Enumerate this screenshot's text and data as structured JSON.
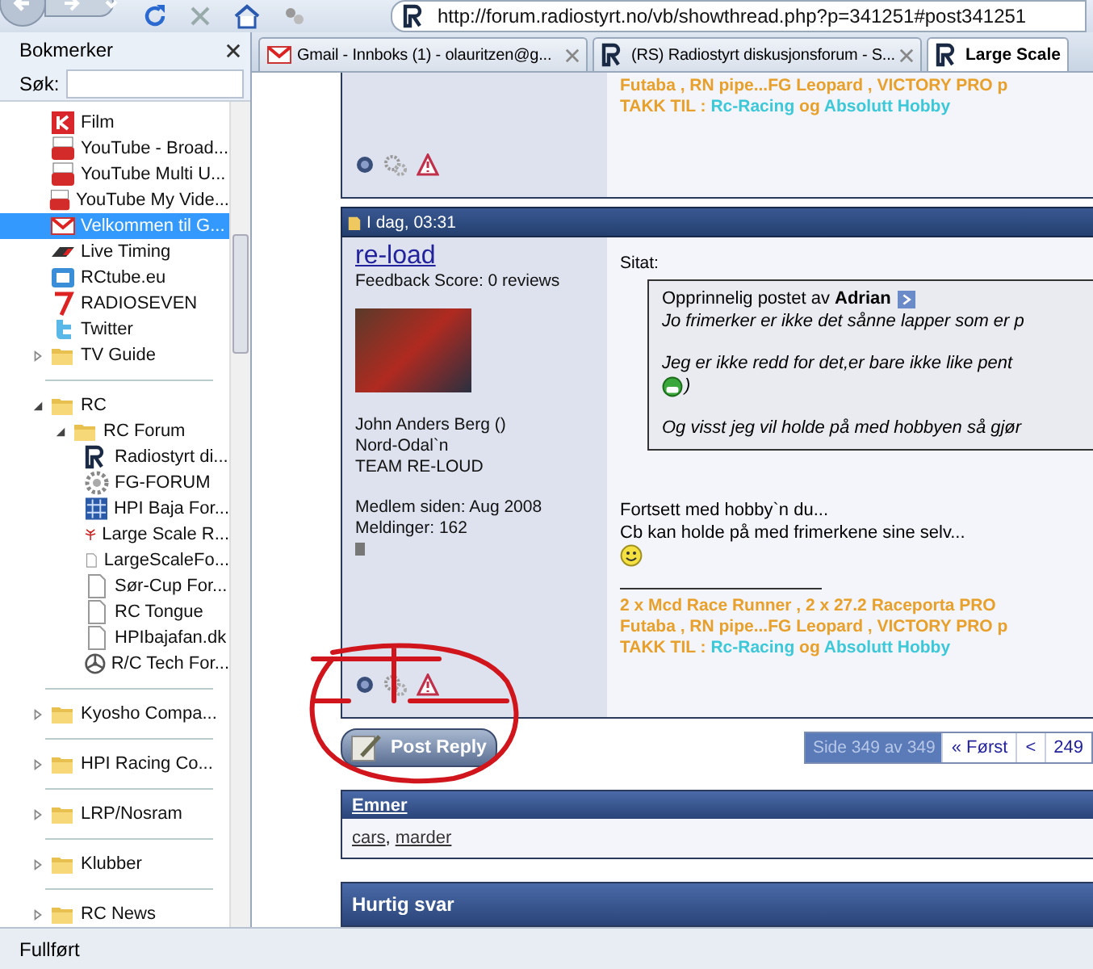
{
  "toolbar": {
    "address": "http://forum.radiostyrt.no/vb/showthread.php?p=341251#post341251"
  },
  "sidebar": {
    "title": "Bokmerker",
    "search": {
      "label": "Søk:"
    },
    "groups": [
      [
        {
          "label": "Film",
          "kind": "film",
          "selected": false
        },
        {
          "label": "YouTube - Broad...",
          "kind": "youtube",
          "selected": false
        },
        {
          "label": "YouTube Multi U...",
          "kind": "youtube",
          "selected": false
        },
        {
          "label": "YouTube My Vide...",
          "kind": "youtube",
          "selected": false
        },
        {
          "label": "Velkommen til G...",
          "kind": "mail",
          "selected": true
        },
        {
          "label": "Live Timing",
          "kind": "timing",
          "selected": false
        },
        {
          "label": "RCtube.eu",
          "kind": "rctube",
          "selected": false
        },
        {
          "label": "RADIOSEVEN",
          "kind": "seven",
          "selected": false
        },
        {
          "label": "Twitter",
          "kind": "twitter",
          "selected": false
        },
        {
          "label": "TV Guide",
          "kind": "folder",
          "selected": false,
          "expanded": false
        }
      ],
      [
        {
          "label": "RC",
          "kind": "folder",
          "selected": false,
          "expanded": true,
          "children": [
            {
              "label": "RC Forum",
              "kind": "folder",
              "selected": false,
              "expanded": true,
              "children": [
                {
                  "label": "Radiostyrt di...",
                  "kind": "rs",
                  "selected": false
                },
                {
                  "label": "FG-FORUM",
                  "kind": "gear",
                  "selected": false
                },
                {
                  "label": "HPI Baja For...",
                  "kind": "grid",
                  "selected": false
                },
                {
                  "label": "Large Scale R...",
                  "kind": "antenna",
                  "selected": false
                },
                {
                  "label": "LargeScaleFo...",
                  "kind": "page",
                  "selected": false
                },
                {
                  "label": "Sør-Cup For...",
                  "kind": "page",
                  "selected": false
                },
                {
                  "label": "RC Tongue",
                  "kind": "page",
                  "selected": false
                },
                {
                  "label": "HPIbajafan.dk",
                  "kind": "page",
                  "selected": false
                },
                {
                  "label": "R/C Tech For...",
                  "kind": "wheel",
                  "selected": false
                }
              ]
            }
          ]
        }
      ],
      [
        {
          "label": "Kyosho Compa...",
          "kind": "folder",
          "selected": false,
          "expanded": false
        }
      ],
      [
        {
          "label": "HPI Racing Co...",
          "kind": "folder",
          "selected": false,
          "expanded": false
        }
      ],
      [
        {
          "label": "LRP/Nosram",
          "kind": "folder",
          "selected": false,
          "expanded": false
        }
      ],
      [
        {
          "label": "Klubber",
          "kind": "folder",
          "selected": false,
          "expanded": false
        }
      ],
      [
        {
          "label": "RC News",
          "kind": "folder",
          "selected": false,
          "expanded": false
        }
      ]
    ]
  },
  "tabs": [
    {
      "label": "Gmail - Innboks (1) - olauritzen@g...",
      "kind": "mail",
      "selected": false
    },
    {
      "label": "(RS) Radiostyrt diskusjonsforum - S...",
      "kind": "rs",
      "selected": false
    },
    {
      "label": "Large Scale",
      "kind": "rs",
      "selected": true
    }
  ],
  "previous_post": {
    "signature": [
      [
        {
          "text": "Futaba , RN pipe...FG Leopard , VICTORY PRO p",
          "color": "#e8a02c"
        }
      ],
      [
        {
          "text": "TAKK TIL : ",
          "color": "#e8a02c"
        },
        {
          "text": "Rc-Racing",
          "color": "#3cc8d8"
        },
        {
          "text": " og ",
          "color": "#e8a02c"
        },
        {
          "text": "Absolutt Hobby",
          "color": "#3cc8d8"
        }
      ]
    ]
  },
  "post": {
    "date": "I dag, 03:31",
    "user": {
      "name": "re-load",
      "feedback": "Feedback Score: 0 reviews",
      "details": [
        "John Anders Berg ()",
        "Nord-Odal`n",
        "TEAM RE-LOUD"
      ],
      "stats": [
        "Medlem siden: Aug 2008",
        "Meldinger: 162"
      ]
    },
    "quote": {
      "label": "Sitat:",
      "author": "Opprinnelig postet av **Adrian**",
      "lines": [
        {
          "kind": "text",
          "text": "Jo frimerker er ikke det sånne lapper som er p"
        },
        {
          "kind": "text",
          "text": "Jeg er ikke redd for det,er bare ikke like pent"
        },
        {
          "kind": "smiley",
          "text": ")"
        },
        {
          "kind": "text",
          "text": "Og visst jeg vil holde på med hobbyen så gjør"
        }
      ]
    },
    "message": [
      "Fortsett med hobby`n du...",
      "Cb kan holde på med frimerkene sine selv..."
    ],
    "signature": [
      [
        {
          "text": "2 x Mcd Race Runner , 2 x 27.2 Raceporta PRO",
          "color": "#e8a02c"
        }
      ],
      [
        {
          "text": "Futaba , RN pipe...FG Leopard , VICTORY PRO p",
          "color": "#e8a02c"
        }
      ],
      [
        {
          "text": "TAKK TIL : ",
          "color": "#e8a02c"
        },
        {
          "text": "Rc-Racing",
          "color": "#3cc8d8"
        },
        {
          "text": " og ",
          "color": "#e8a02c"
        },
        {
          "text": "Absolutt Hobby",
          "color": "#3cc8d8"
        }
      ]
    ]
  },
  "reply_button": "Post Reply",
  "pagination": {
    "info": "Side 349 av 349",
    "links": [
      "« Først",
      "<",
      "249"
    ]
  },
  "tags": {
    "title": "Emner",
    "items": [
      "cars",
      "marder"
    ],
    "separator": ","
  },
  "quick_reply": {
    "title": "Hurtig svar"
  },
  "status_bar": "Fullført"
}
